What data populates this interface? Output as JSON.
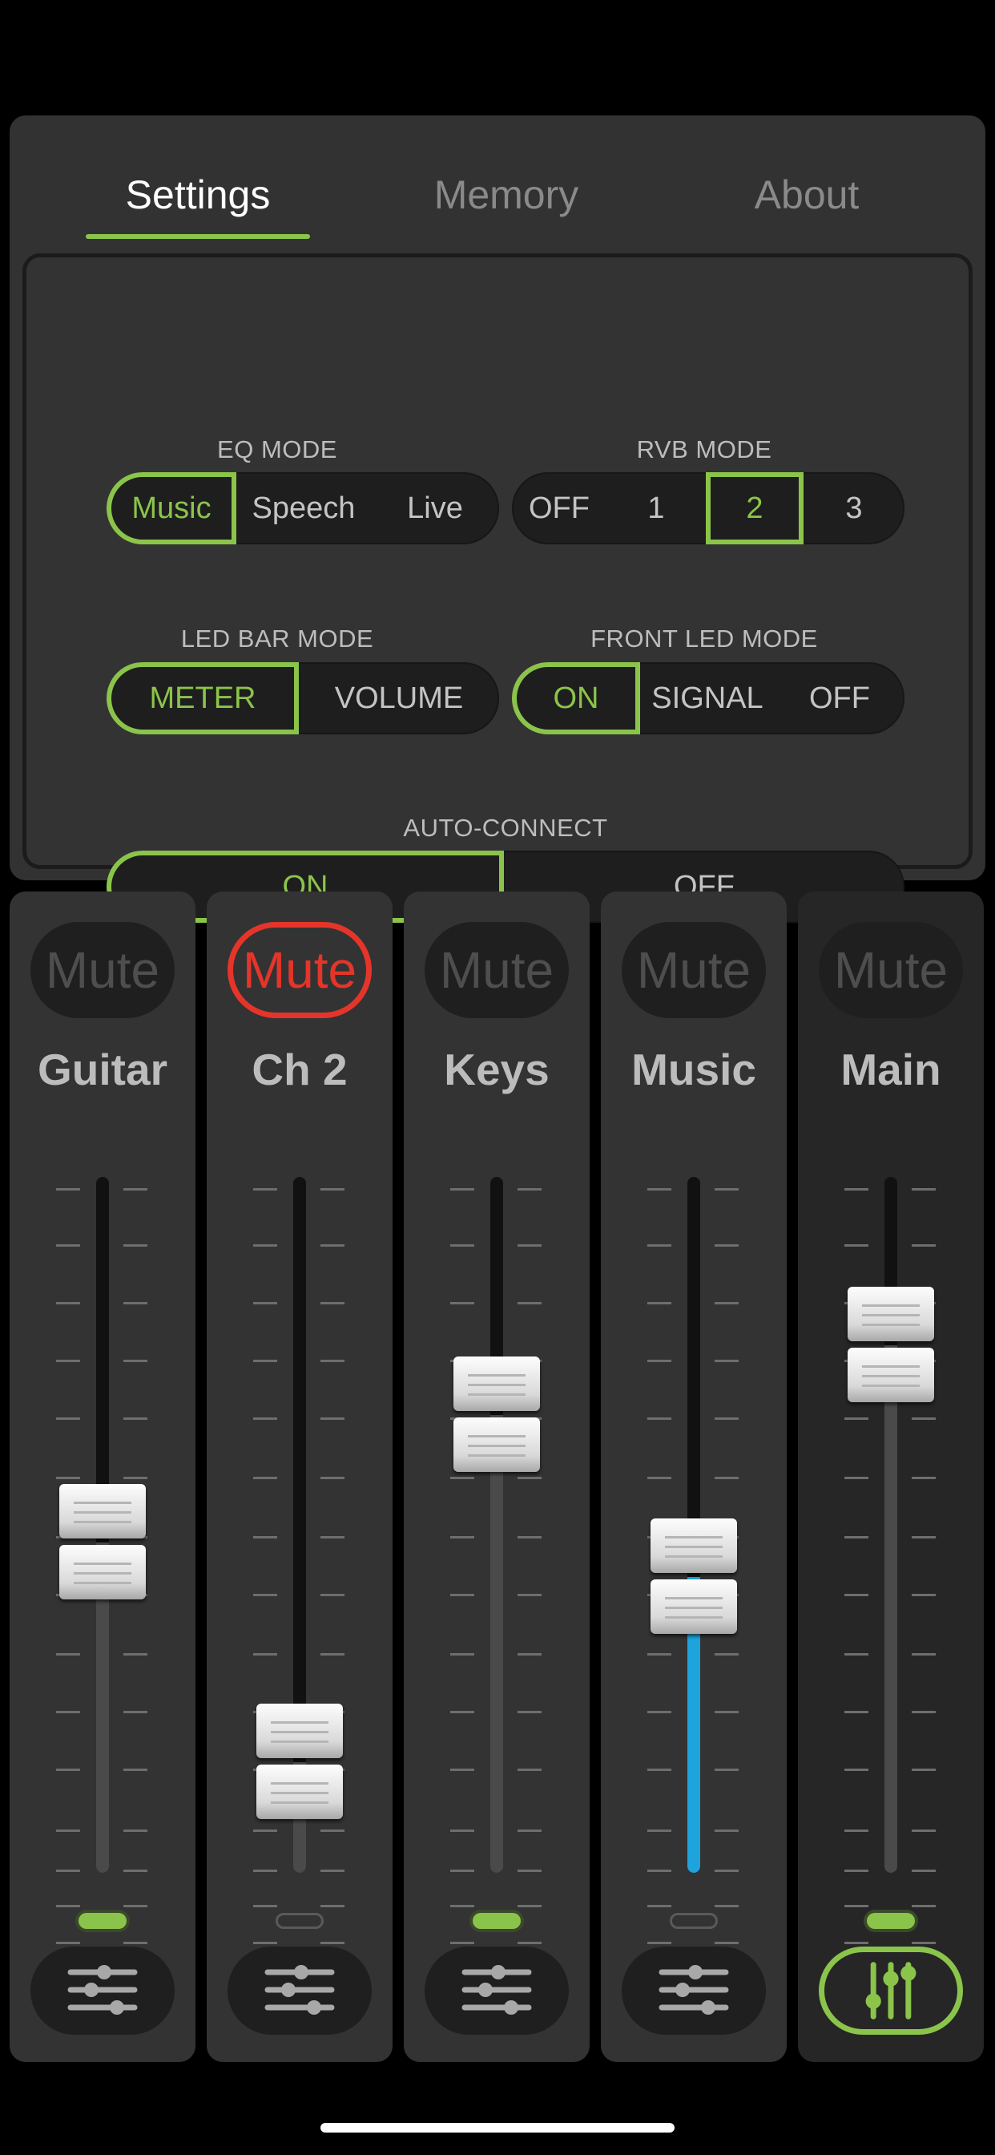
{
  "tabs": [
    {
      "label": "Settings",
      "active": true
    },
    {
      "label": "Memory",
      "active": false
    },
    {
      "label": "About",
      "active": false
    }
  ],
  "settings": {
    "eq_mode": {
      "label": "EQ MODE",
      "options": [
        "Music",
        "Speech",
        "Live"
      ],
      "selected": "Music"
    },
    "rvb_mode": {
      "label": "RVB MODE",
      "options": [
        "OFF",
        "1",
        "2",
        "3"
      ],
      "selected": "2"
    },
    "led_bar_mode": {
      "label": "LED BAR MODE",
      "options": [
        "METER",
        "VOLUME"
      ],
      "selected": "METER"
    },
    "front_led_mode": {
      "label": "FRONT LED MODE",
      "options": [
        "ON",
        "SIGNAL",
        "OFF"
      ],
      "selected": "ON"
    },
    "auto_connect": {
      "label": "AUTO-CONNECT",
      "options": [
        "ON",
        "OFF"
      ],
      "selected": "ON"
    }
  },
  "channels": [
    {
      "name": "Guitar",
      "mute_label": "Mute",
      "muted": false,
      "fader_level": 0.47,
      "led_lit": true
    },
    {
      "name": "Ch 2",
      "mute_label": "Mute",
      "muted": true,
      "fader_level": 0.09,
      "led_lit": false
    },
    {
      "name": "Keys",
      "mute_label": "Mute",
      "muted": false,
      "fader_level": 0.69,
      "led_lit": true
    },
    {
      "name": "Music",
      "mute_label": "Mute",
      "muted": false,
      "fader_level": 0.41,
      "led_lit": false
    },
    {
      "name": "Main",
      "mute_label": "Mute",
      "muted": false,
      "fader_level": 0.81,
      "led_lit": true
    }
  ],
  "colors": {
    "accent": "#8bc44a",
    "mute_active": "#e5352a",
    "level_blue": "#1ea3dc"
  },
  "icons": {
    "channel_eq": "sliders-icon",
    "main_eq": "mixer-icon"
  }
}
